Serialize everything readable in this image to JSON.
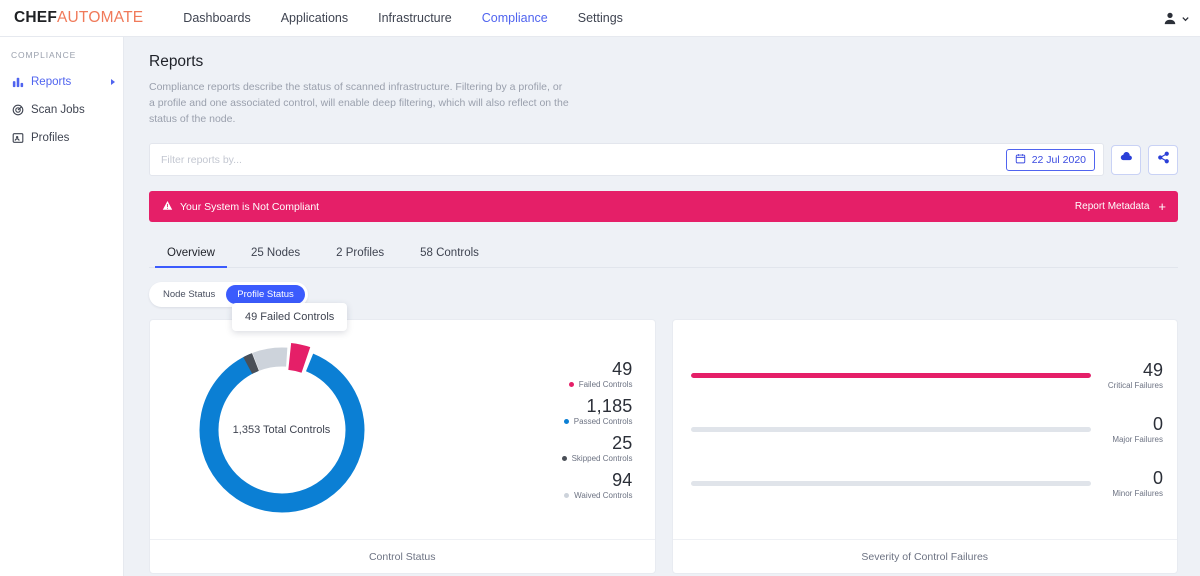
{
  "topnav": {
    "brand_bold": "CHEF",
    "brand_light": "AUTOMATE",
    "links": [
      {
        "label": "Dashboards",
        "active": false
      },
      {
        "label": "Applications",
        "active": false
      },
      {
        "label": "Infrastructure",
        "active": false
      },
      {
        "label": "Compliance",
        "active": true
      },
      {
        "label": "Settings",
        "active": false
      }
    ],
    "user_icon": "user-icon",
    "user_caret_icon": "chevron-down-icon"
  },
  "sidebar": {
    "heading": "COMPLIANCE",
    "items": [
      {
        "label": "Reports",
        "icon": "bar-chart-icon",
        "active": true,
        "has_caret": true
      },
      {
        "label": "Scan Jobs",
        "icon": "radar-icon",
        "active": false,
        "has_caret": false
      },
      {
        "label": "Profiles",
        "icon": "profile-card-icon",
        "active": false,
        "has_caret": false
      }
    ]
  },
  "page": {
    "title": "Reports",
    "description": "Compliance reports describe the status of scanned infrastructure. Filtering by a profile, or a profile and one associated control, will enable deep filtering, which will also reflect on the status of the node."
  },
  "filterbar": {
    "placeholder": "Filter reports by...",
    "value": "",
    "date_label": "22 Jul 2020",
    "calendar_icon": "calendar-icon",
    "download_icon": "cloud-download-icon",
    "share_icon": "share-icon"
  },
  "banner": {
    "warning_icon": "warning-triangle-icon",
    "message": "Your System is Not Compliant",
    "metadata_label": "Report Metadata",
    "expand_icon": "+",
    "color": "#e51f68"
  },
  "tabs": [
    {
      "label": "Overview",
      "active": true
    },
    {
      "label": "25 Nodes",
      "active": false
    },
    {
      "label": "2 Profiles",
      "active": false
    },
    {
      "label": "58 Controls",
      "active": false
    }
  ],
  "status_toggle": {
    "options": [
      {
        "label": "Node Status",
        "selected": false
      },
      {
        "label": "Profile Status",
        "selected": true
      }
    ]
  },
  "tooltip": {
    "text": "49 Failed Controls"
  },
  "cards": [
    {
      "title": "Control Status"
    },
    {
      "title": "Severity of Control Failures"
    }
  ],
  "chart_data": [
    {
      "type": "pie",
      "title": "Control Status",
      "center_label": "1,353 Total Controls",
      "total": 1353,
      "total_label": "Total Controls",
      "legend_position": "right",
      "categories": [
        "Failed Controls",
        "Passed Controls",
        "Skipped Controls",
        "Waived Controls"
      ],
      "values": [
        49,
        1185,
        25,
        94
      ],
      "value_labels": [
        "49",
        "1,185",
        "25",
        "94"
      ],
      "colors": [
        "#e51f68",
        "#0b7fd4",
        "#4a4f57",
        "#cdd3db"
      ],
      "highlighted_slice": "Failed Controls",
      "annotations": [
        "49 Failed Controls"
      ]
    },
    {
      "type": "bar",
      "title": "Severity of Control Failures",
      "orientation": "horizontal",
      "categories": [
        "Critical Failures",
        "Major Failures",
        "Minor Failures"
      ],
      "values": [
        49,
        0,
        0
      ],
      "value_labels": [
        "49",
        "0",
        "0"
      ],
      "max": 49,
      "colors": [
        "#e51f68",
        "#e0e4ea",
        "#e0e4ea"
      ],
      "xlabel": "",
      "ylabel": "",
      "grid": false
    }
  ],
  "colors": {
    "accent_blue": "#3b5bfd",
    "brand_orange": "#f07a5a",
    "danger_pink": "#e51f68",
    "passed_blue": "#0b7fd4",
    "skipped_gray": "#4a4f57",
    "waived_gray": "#cdd3db",
    "page_bg": "#eef1f6"
  }
}
